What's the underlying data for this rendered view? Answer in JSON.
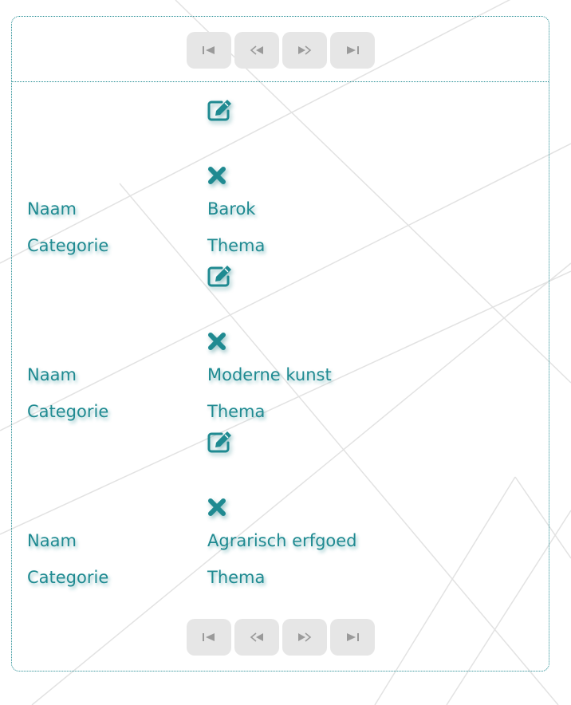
{
  "pager": {
    "first_icon": "skip-first-icon",
    "prev_icon": "skip-previous-icon",
    "next_icon": "skip-next-icon",
    "last_icon": "skip-last-icon"
  },
  "records": [
    {
      "naam_label": "Naam",
      "naam": "Barok",
      "categorie_label": "Categorie",
      "categorie": "Thema",
      "edit_icon": "edit-icon",
      "delete_icon": "delete-x-icon"
    },
    {
      "naam_label": "Naam",
      "naam": "Moderne kunst",
      "categorie_label": "Categorie",
      "categorie": "Thema",
      "edit_icon": "edit-icon",
      "delete_icon": "delete-x-icon"
    },
    {
      "naam_label": "Naam",
      "naam": "Agrarisch erfgoed",
      "categorie_label": "Categorie",
      "categorie": "Thema",
      "edit_icon": "edit-icon",
      "delete_icon": "delete-x-icon"
    }
  ],
  "colors": {
    "accent": "#1f8a91",
    "button_bg": "#e6e6e6",
    "button_icon": "#9a9a9a"
  }
}
